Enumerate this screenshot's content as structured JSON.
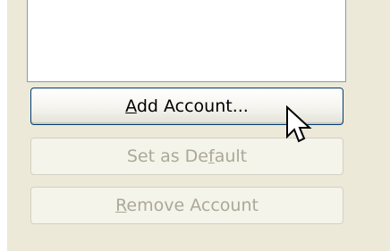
{
  "buttons": {
    "add": {
      "before": "",
      "mnemonic": "A",
      "after": "dd Account..."
    },
    "set_default": {
      "before": "Set as De",
      "mnemonic": "f",
      "after": "ault"
    },
    "remove": {
      "before": "",
      "mnemonic": "R",
      "after": "emove Account"
    }
  },
  "colors": {
    "panel_background": "#ece9d8",
    "list_border": "#7f9db9",
    "active_button_border": "#003c74",
    "disabled_text": "#aca899"
  },
  "icons": {
    "cursor": "mouse-pointer-arrow"
  }
}
